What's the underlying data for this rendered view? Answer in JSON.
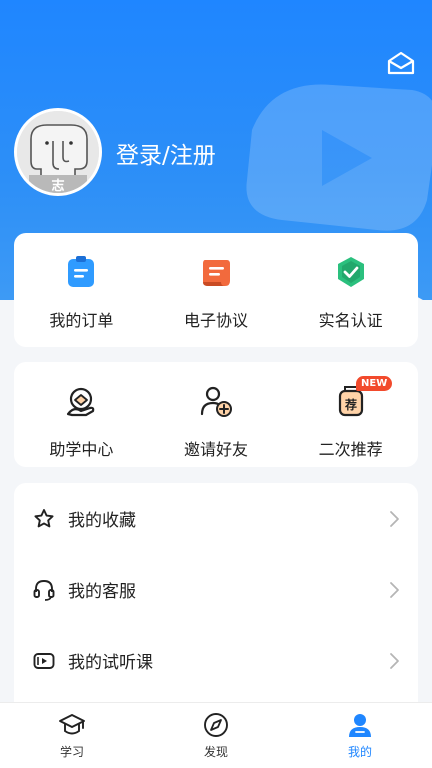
{
  "header": {
    "login_label": "登录/注册",
    "avatar_text": "志",
    "accent": "#1f86ff"
  },
  "quick_actions": [
    {
      "label": "我的订单",
      "icon": "clipboard-icon"
    },
    {
      "label": "电子协议",
      "icon": "scroll-icon"
    },
    {
      "label": "实名认证",
      "icon": "shield-check-icon"
    }
  ],
  "services": [
    {
      "label": "助学中心",
      "icon": "support-center-icon"
    },
    {
      "label": "邀请好友",
      "icon": "add-friend-icon"
    },
    {
      "label": "二次推荐",
      "icon": "recommend-icon",
      "badge": "NEW"
    }
  ],
  "menu": [
    {
      "label": "我的收藏",
      "icon": "star-icon"
    },
    {
      "label": "我的客服",
      "icon": "headset-icon"
    },
    {
      "label": "我的试听课",
      "icon": "video-icon"
    }
  ],
  "tabbar": [
    {
      "label": "学习",
      "icon": "graduation-cap-icon",
      "active": false
    },
    {
      "label": "发现",
      "icon": "compass-icon",
      "active": false
    },
    {
      "label": "我的",
      "icon": "user-icon",
      "active": true
    }
  ]
}
